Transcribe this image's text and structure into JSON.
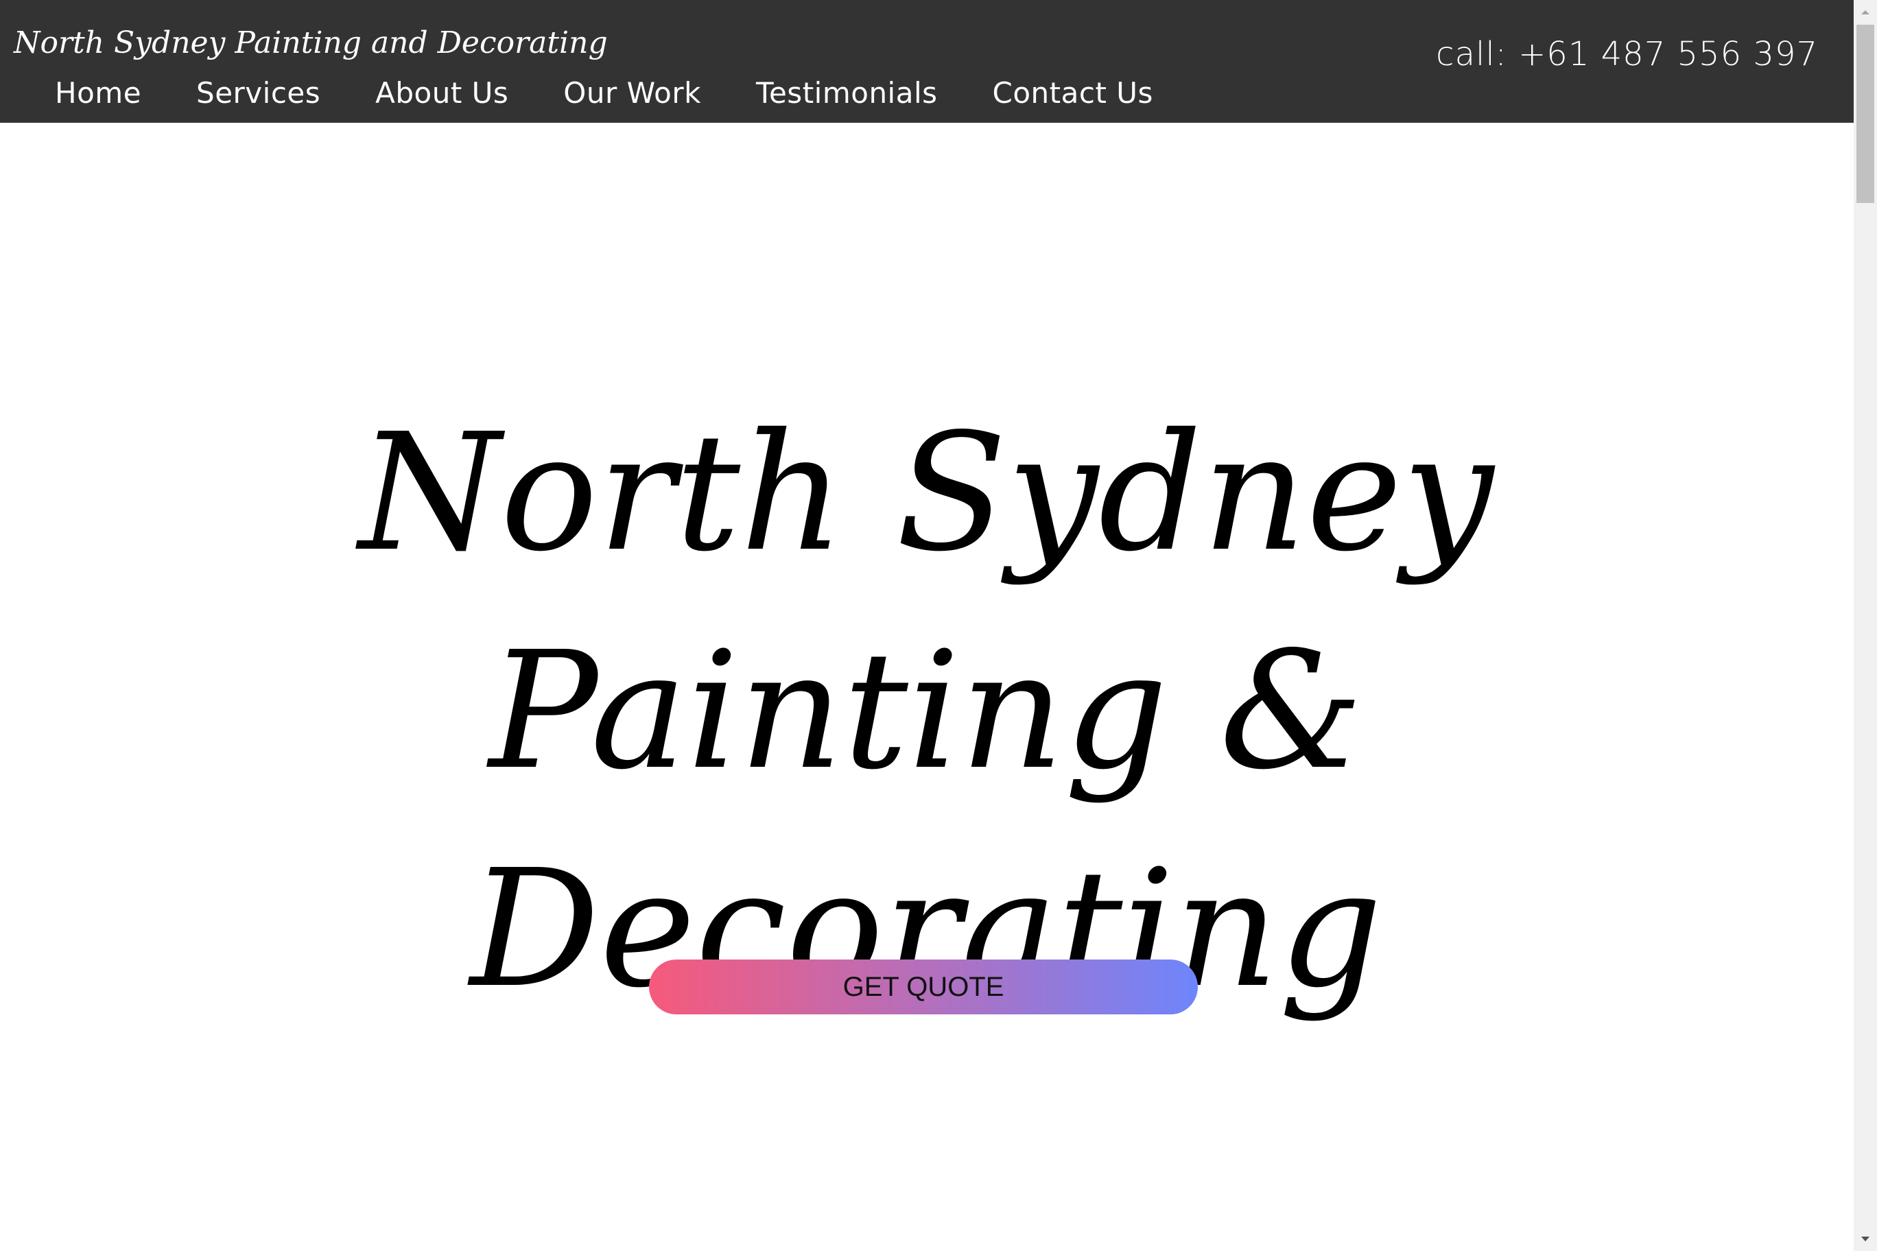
{
  "header": {
    "brand": "North Sydney Painting and Decorating",
    "phone": "call: +61 487 556 397",
    "nav": [
      {
        "label": "Home"
      },
      {
        "label": "Services"
      },
      {
        "label": "About Us"
      },
      {
        "label": "Our Work"
      },
      {
        "label": "Testimonials"
      },
      {
        "label": "Contact Us"
      }
    ]
  },
  "hero": {
    "title": "North Sydney Painting & Decorating",
    "cta_label": "GET QUOTE"
  },
  "colors": {
    "header_bg": "#333333",
    "page_bg": "#ffffff",
    "cta_gradient_start": "#f65a7b",
    "cta_gradient_end": "#6e85fb"
  },
  "icons": {
    "scroll_up": "chevron-up-icon",
    "scroll_down": "chevron-down-icon"
  }
}
